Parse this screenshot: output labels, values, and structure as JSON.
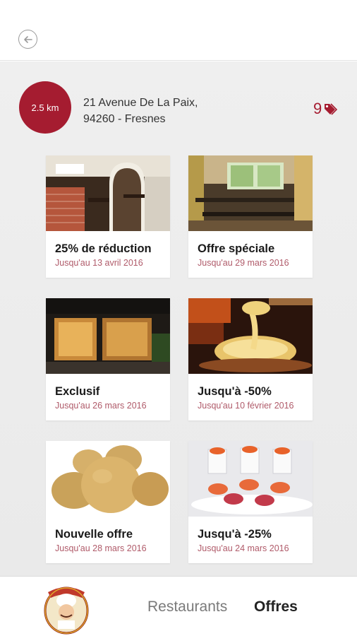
{
  "header": {
    "back_icon": "back-arrow-icon"
  },
  "restaurant": {
    "distance": "2.5 km",
    "address_line1": "21 Avenue De La Paix,",
    "address_line2": "94260 - Fresnes",
    "offer_count": "9",
    "offer_icon": "tags-icon",
    "accent_color": "#a51c30"
  },
  "offers": [
    {
      "title": "25% de réduction",
      "date": "Jusqu'au 13 avril 2016",
      "image": "restaurant-interior-photo"
    },
    {
      "title": "Offre spéciale",
      "date": "Jusqu'au 29 mars 2016",
      "image": "dining-room-photo"
    },
    {
      "title": "Exclusif",
      "date": "Jusqu'au 26 mars 2016",
      "image": "bistro-storefront-photo"
    },
    {
      "title": "Jusqu'à -50%",
      "date": "Jusqu'au 10 février 2016",
      "image": "cheese-fondue-photo"
    },
    {
      "title": "Nouvelle offre",
      "date": "Jusqu'au 28 mars 2016",
      "image": "potatoes-photo"
    },
    {
      "title": "Jusqu'à -25%",
      "date": "Jusqu'au 24 mars 2016",
      "image": "appetizers-photo"
    }
  ],
  "bottom_nav": {
    "logo": "chef-logo",
    "restaurants_label": "Restaurants",
    "offres_label": "Offres",
    "active": "Offres"
  }
}
